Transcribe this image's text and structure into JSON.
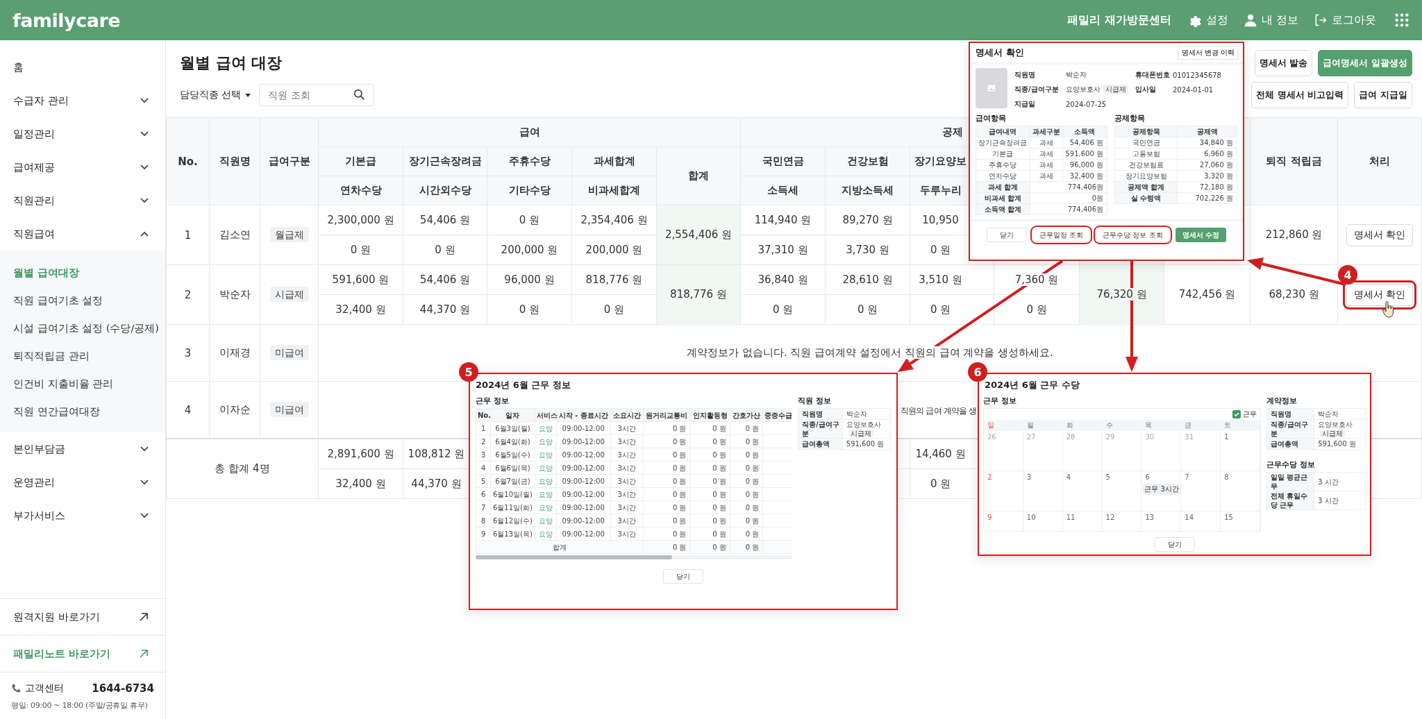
{
  "header": {
    "logo": "familycare",
    "center_name": "패밀리 재가방문센터",
    "links": [
      {
        "label": "설정",
        "kind": "settings"
      },
      {
        "label": "내 정보",
        "kind": "profile"
      },
      {
        "label": "로그아웃",
        "kind": "logout"
      }
    ]
  },
  "sidebar": {
    "menu": [
      {
        "label": "홈",
        "kind": "link"
      },
      {
        "label": "수급자 관리",
        "kind": "group",
        "expanded": false
      },
      {
        "label": "일정관리",
        "kind": "group",
        "expanded": false
      },
      {
        "label": "급여제공",
        "kind": "group",
        "expanded": false
      },
      {
        "label": "직원관리",
        "kind": "group",
        "expanded": false
      },
      {
        "label": "직원급여",
        "kind": "group",
        "expanded": true,
        "children": [
          {
            "label": "월별 급여대장",
            "selected": true
          },
          {
            "label": "직원 급여기초 설정",
            "selected": false
          },
          {
            "label": "시설 급여기초 설정 (수당/공제)",
            "selected": false
          },
          {
            "label": "퇴직적립금 관리",
            "selected": false
          },
          {
            "label": "인건비 지출비율 관리",
            "selected": false
          },
          {
            "label": "직원 연간급여대장",
            "selected": false
          }
        ]
      },
      {
        "label": "본인부담금",
        "kind": "group",
        "expanded": false
      },
      {
        "label": "운영관리",
        "kind": "group",
        "expanded": false
      },
      {
        "label": "부가서비스",
        "kind": "group",
        "expanded": false
      }
    ],
    "shortcuts": [
      {
        "label": "원격지원 바로가기",
        "highlighted": false
      },
      {
        "label": "패밀리노트 바로가기",
        "highlighted": true
      }
    ],
    "support": {
      "label": "고객센터",
      "phone": "1644-6734",
      "hours": "평일: 09:00 ~ 18:00 (주말/공휴일 휴무)"
    }
  },
  "page": {
    "title": "월별 급여 대장",
    "filter": "담당직종 선택",
    "search": {
      "placeholder": "직원 조회"
    },
    "buttons": [
      {
        "label": "명세서 발송",
        "primary": false
      },
      {
        "label": "급여명세서 일괄생성",
        "primary": true
      }
    ],
    "secondary_buttons": [
      {
        "label": "전체 명세서 비고입력",
        "primary": false
      },
      {
        "label": "급여 지급일",
        "primary": false
      }
    ]
  },
  "table": {
    "header": {
      "no": "No.",
      "name": "직원명",
      "pay_type": "급여구분",
      "pay": {
        "label": "급여",
        "total": "합계",
        "columns": [
          {
            "top": "기본급",
            "bottom": "연차수당"
          },
          {
            "top": "장기근속장려금",
            "bottom": "시간외수당"
          },
          {
            "top": "주휴수당",
            "bottom": "기타수당"
          },
          {
            "top": "과세합계",
            "bottom": "비과세합계"
          }
        ]
      },
      "deduction": {
        "label": "공제",
        "columns": [
          {
            "top": "국민연금",
            "bottom": "소득세"
          },
          {
            "top": "건강보험",
            "bottom": "지방소득세"
          },
          {
            "top": "장기요양보",
            "bottom": "두루누리"
          }
        ]
      },
      "retirement": "퇴직 적립금",
      "action": "처리"
    },
    "rows": [
      {
        "kind": "payroll",
        "no": "1",
        "name": "김소연",
        "pay_type": "월급제",
        "pay": [
          [
            "2,300,000 원",
            "0 원"
          ],
          [
            "54,406 원",
            "0 원"
          ],
          [
            "0 원",
            "200,000 원"
          ],
          [
            "2,354,406 원",
            "200,000 원"
          ]
        ],
        "pay_total": "2,554,406 원",
        "deductions": [
          [
            "114,940 원",
            "37,310 원"
          ],
          [
            "89,270 원",
            "3,730 원"
          ],
          [
            "10,950",
            "0 원"
          ]
        ],
        "retirement": "212,860 원",
        "action": {
          "label": "명세서 확인",
          "highlighted": false
        }
      },
      {
        "kind": "payroll",
        "no": "2",
        "name": "박순자",
        "pay_type": "시급제",
        "pay": [
          [
            "591,600 원",
            "32,400 원"
          ],
          [
            "54,406 원",
            "44,370 원"
          ],
          [
            "96,000 원",
            "0 원"
          ],
          [
            "818,776 원",
            "0 원"
          ]
        ],
        "pay_total": "818,776 원",
        "deductions": [
          [
            "36,840 원",
            "0 원"
          ],
          [
            "28,610 원",
            "0 원"
          ],
          [
            "3,510 원",
            "0 원"
          ],
          [
            "7,360 원",
            "0 원"
          ]
        ],
        "deduction_total": "76,320 원",
        "net": "742,456 원",
        "retirement": "68,230 원",
        "action": {
          "label": "명세서 확인",
          "highlighted": true,
          "callout": "4"
        }
      },
      {
        "kind": "no_contract",
        "no": "3",
        "name": "이재경",
        "pay_type": "미급여",
        "message": "계약정보가 없습니다. 직원 급여계약 설정에서 직원의 급여 계약을 생성하세요.",
        "clipped": false
      },
      {
        "kind": "no_contract",
        "no": "4",
        "name": "이자순",
        "pay_type": "미급여",
        "message": "직원의 급여 계약을 생",
        "clipped": true
      }
    ],
    "total": {
      "label": "총 합계 4명",
      "pay": [
        [
          "2,891,600 원",
          "32,400 원"
        ],
        [
          "108,812 원",
          "44,370 원"
        ]
      ],
      "deductions": {
        "long_term_care": [
          "14,460 원",
          "0 원"
        ]
      }
    }
  },
  "statement_dialog": {
    "title": "명세서 확인",
    "history_button": "명세서 변경 이력",
    "profile": [
      {
        "label": "직원명",
        "value": "박순자"
      },
      {
        "label": "휴대폰번호",
        "value": "01012345678"
      },
      {
        "label": "직종/급여구분",
        "value": "요양보호사",
        "tag": "시급제"
      },
      {
        "label": "입사일",
        "value": "2024-01-01"
      },
      {
        "label": "지급일",
        "value": "2024-07-25"
      }
    ],
    "earnings": {
      "title": "급여항목",
      "columns": [
        "급여내역",
        "과세구분",
        "소득액"
      ],
      "rows": [
        [
          "장기근속장려금",
          "과세",
          "54,406 원"
        ],
        [
          "기본급",
          "과세",
          "591,600 원"
        ],
        [
          "주휴수당",
          "과세",
          "96,000 원"
        ],
        [
          "연차수당",
          "과세",
          "32,400 원"
        ]
      ],
      "summary": [
        [
          "과세 합계",
          "774,406원"
        ],
        [
          "비과세 합계",
          "0원"
        ],
        [
          "소득액 합계",
          "774,406원"
        ]
      ]
    },
    "deductions": {
      "title": "공제항목",
      "columns": [
        "공제항목",
        "공제액"
      ],
      "rows": [
        [
          "국민연금",
          "34,840 원"
        ],
        [
          "고용보험",
          "6,960 원"
        ],
        [
          "건강보험료",
          "27,060 원"
        ],
        [
          "장기요양보험",
          "3,320 원"
        ]
      ],
      "summary": [
        [
          "공제액 합계",
          "72,180 원"
        ],
        [
          "실 수령액",
          "702,226 원"
        ]
      ]
    },
    "buttons": [
      {
        "label": "닫기",
        "primary": false,
        "highlighted": false
      },
      {
        "label": "근무일정 조회",
        "primary": false,
        "highlighted": true
      },
      {
        "label": "근무수당 정보 조회",
        "primary": false,
        "highlighted": true
      },
      {
        "label": "명세서 수정",
        "primary": true,
        "highlighted": false
      }
    ]
  },
  "work_info_dialog": {
    "badge": "5",
    "title": "2024년 6월 근무 정보",
    "section": "근무 정보",
    "columns": [
      "No.",
      "일자",
      "서비스",
      "시작 - 종료시간",
      "소요시간",
      "원거리교통비",
      "인지활동형",
      "간호가산",
      "중증수급"
    ],
    "rows": [
      {
        "no": "1",
        "date": "6월3일(월)",
        "service": "요양",
        "time": "09:00-12:00",
        "duration": "3시간",
        "amounts": [
          "0 원",
          "0 원",
          "0 원"
        ]
      },
      {
        "no": "2",
        "date": "6월4일(화)",
        "service": "요양",
        "time": "09:00-12:00",
        "duration": "3시간",
        "amounts": [
          "0 원",
          "0 원",
          "0 원"
        ]
      },
      {
        "no": "3",
        "date": "6월5일(수)",
        "service": "요양",
        "time": "09:00-12:00",
        "duration": "3시간",
        "amounts": [
          "0 원",
          "0 원",
          "0 원"
        ]
      },
      {
        "no": "4",
        "date": "6월6일(목)",
        "service": "요양",
        "time": "09:00-12:00",
        "duration": "3시간",
        "amounts": [
          "0 원",
          "0 원",
          "0 원"
        ]
      },
      {
        "no": "5",
        "date": "6월7일(금)",
        "service": "요양",
        "time": "09:00-12:00",
        "duration": "3시간",
        "amounts": [
          "0 원",
          "0 원",
          "0 원"
        ]
      },
      {
        "no": "6",
        "date": "6월10일(월)",
        "service": "요양",
        "time": "09:00-12:00",
        "duration": "3시간",
        "amounts": [
          "0 원",
          "0 원",
          "0 원"
        ]
      },
      {
        "no": "7",
        "date": "6월11일(화)",
        "service": "요양",
        "time": "09:00-12:00",
        "duration": "3시간",
        "amounts": [
          "0 원",
          "0 원",
          "0 원"
        ]
      },
      {
        "no": "8",
        "date": "6월12일(수)",
        "service": "요양",
        "time": "09:00-12:00",
        "duration": "3시간",
        "amounts": [
          "0 원",
          "0 원",
          "0 원"
        ]
      },
      {
        "no": "9",
        "date": "6월13일(목)",
        "service": "요양",
        "time": "09:00-12:00",
        "duration": "3시간",
        "amounts": [
          "0 원",
          "0 원",
          "0 원"
        ]
      }
    ],
    "total": {
      "label": "합계",
      "amounts": [
        "0 원",
        "0 원",
        "0 원"
      ]
    },
    "staff": {
      "title": "직원 정보",
      "rows": [
        {
          "label": "직원명",
          "value": "박순자"
        },
        {
          "label": "직종/급여구분",
          "value": "요양보호사",
          "tag": "시급제"
        },
        {
          "label": "급여총액",
          "value": "591,600 원"
        }
      ]
    },
    "close": "닫기"
  },
  "allowance_dialog": {
    "badge": "6",
    "title": "2024년 6월 근무 수당",
    "section": "근무 정보",
    "legend": {
      "label": "근무",
      "checked": true
    },
    "weekdays": [
      {
        "label": "일",
        "holiday": true
      },
      {
        "label": "월",
        "holiday": false
      },
      {
        "label": "화",
        "holiday": false
      },
      {
        "label": "수",
        "holiday": false
      },
      {
        "label": "목",
        "holiday": false
      },
      {
        "label": "금",
        "holiday": false
      },
      {
        "label": "토",
        "holiday": false
      }
    ],
    "weeks": [
      [
        {
          "day": "26",
          "holiday": false,
          "faded": true
        },
        {
          "day": "27",
          "holiday": false,
          "faded": true
        },
        {
          "day": "28",
          "holiday": false,
          "faded": true
        },
        {
          "day": "29",
          "holiday": false,
          "faded": true
        },
        {
          "day": "30",
          "holiday": false,
          "faded": true
        },
        {
          "day": "31",
          "holiday": false,
          "faded": true
        },
        {
          "day": "1",
          "holiday": false,
          "faded": false
        }
      ],
      [
        {
          "day": "2",
          "holiday": true,
          "faded": false
        },
        {
          "day": "3",
          "holiday": false,
          "faded": false
        },
        {
          "day": "4",
          "holiday": false,
          "faded": false
        },
        {
          "day": "5",
          "holiday": false,
          "faded": false
        },
        {
          "day": "6",
          "holiday": false,
          "faded": false,
          "events": [
            {
              "label": "근무",
              "hours": "3시간"
            }
          ]
        },
        {
          "day": "7",
          "holiday": false,
          "faded": false
        },
        {
          "day": "8",
          "holiday": false,
          "faded": false
        }
      ],
      [
        {
          "day": "9",
          "holiday": true,
          "faded": false
        },
        {
          "day": "10",
          "holiday": false,
          "faded": false
        },
        {
          "day": "11",
          "holiday": false,
          "faded": false
        },
        {
          "day": "12",
          "holiday": false,
          "faded": false
        },
        {
          "day": "13",
          "holiday": false,
          "faded": false
        },
        {
          "day": "14",
          "holiday": false,
          "faded": false
        },
        {
          "day": "15",
          "holiday": false,
          "faded": false
        }
      ]
    ],
    "contract": {
      "title": "계약정보",
      "rows": [
        {
          "label": "직원명",
          "value": "박순자"
        },
        {
          "label": "직종/급여구분",
          "value": "요양보호사",
          "tag": "시급제"
        },
        {
          "label": "급여총액",
          "value": "591,600 원"
        }
      ]
    },
    "allowance": {
      "title": "근무수당 정보",
      "rows": [
        {
          "label": "일일 평균근무",
          "value": "3 시간"
        },
        {
          "label": "전체 휴일수당 근무",
          "value": "3 시간"
        }
      ]
    },
    "close": "닫기"
  }
}
